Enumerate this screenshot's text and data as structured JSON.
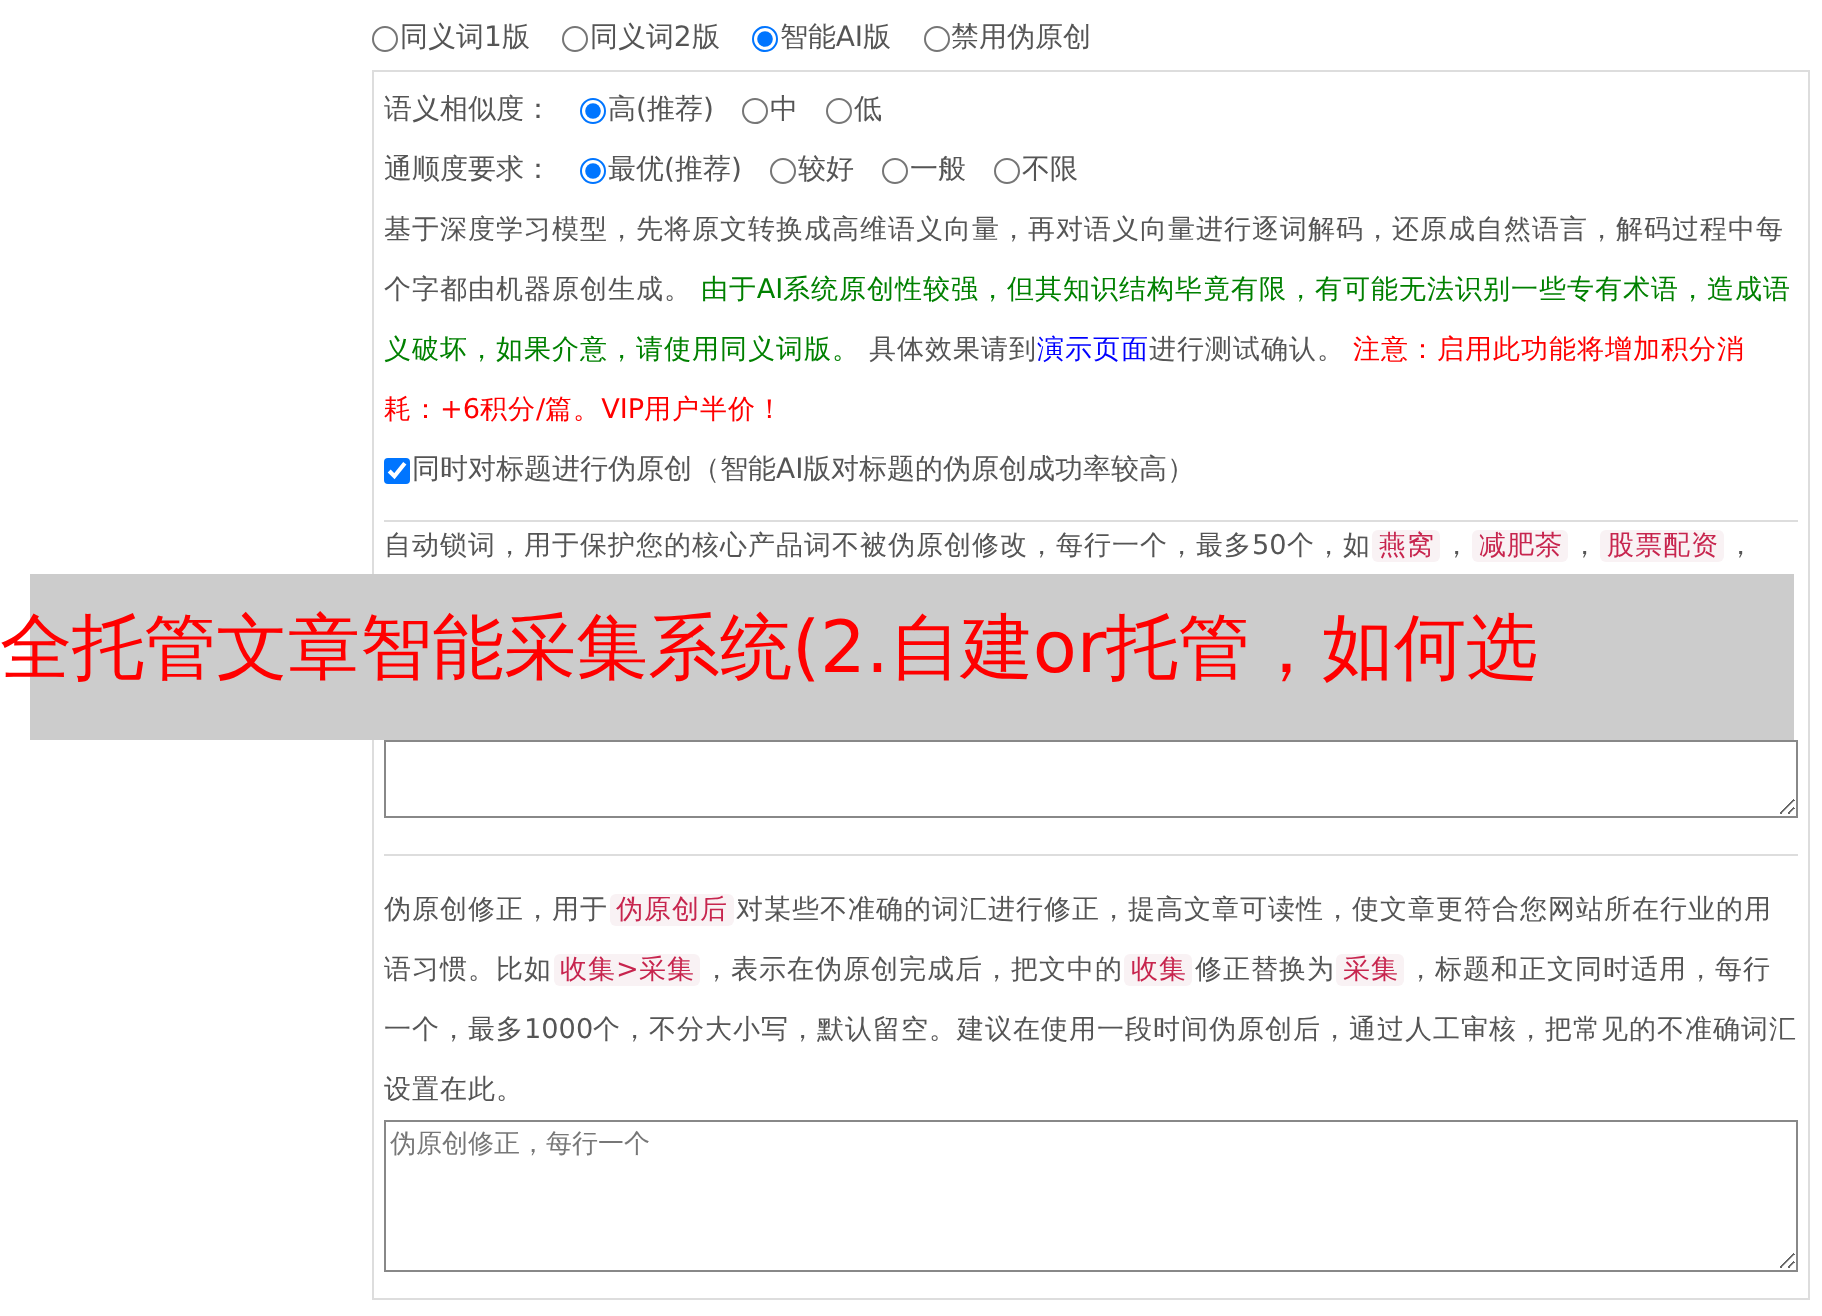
{
  "mode_options": [
    {
      "label": "同义词1版",
      "selected": false
    },
    {
      "label": "同义词2版",
      "selected": false
    },
    {
      "label": "智能AI版",
      "selected": true
    },
    {
      "label": "禁用伪原创",
      "selected": false
    }
  ],
  "similarity": {
    "label": "语义相似度：",
    "options": [
      {
        "label": "高(推荐)",
        "selected": true
      },
      {
        "label": "中",
        "selected": false
      },
      {
        "label": "低",
        "selected": false
      }
    ]
  },
  "fluency": {
    "label": "通顺度要求：",
    "options": [
      {
        "label": "最优(推荐)",
        "selected": true
      },
      {
        "label": "较好",
        "selected": false
      },
      {
        "label": "一般",
        "selected": false
      },
      {
        "label": "不限",
        "selected": false
      }
    ]
  },
  "ai_description": [
    {
      "kind": "plain",
      "text": "基于深度学习模型，先将原文转换成高维语义向量，再对语义向量进行逐词解码，还原成自然语言，解码过程中每个字都由机器原创生成。 "
    },
    {
      "kind": "green",
      "text": "由于AI系统原创性较强，但其知识结构毕竟有限，有可能无法识别一些专有术语，造成语义破坏，如果介意，请使用同义词版。"
    },
    {
      "kind": "plain",
      "text": " 具体效果请到"
    },
    {
      "kind": "link",
      "text": "演示页面"
    },
    {
      "kind": "plain",
      "text": "进行测试确认。 "
    },
    {
      "kind": "red",
      "text": "注意：启用此功能将增加积分消耗：+6积分/篇。VIP用户半价！"
    }
  ],
  "title_checkbox": {
    "label": "同时对标题进行伪原创（智能AI版对标题的伪原创成功率较高）",
    "checked": true
  },
  "lock_words": {
    "description": [
      {
        "kind": "text",
        "text": "自动锁词，用于保护您的核心产品词不被伪原创修改，每行一个，最多50个，如"
      },
      {
        "kind": "tag",
        "text": "燕窝"
      },
      {
        "kind": "text",
        "text": "，"
      },
      {
        "kind": "tag",
        "text": "减肥茶"
      },
      {
        "kind": "text",
        "text": "，"
      },
      {
        "kind": "tag",
        "text": "股票配资"
      },
      {
        "kind": "text",
        "text": "，"
      }
    ]
  },
  "correction": {
    "description": [
      {
        "kind": "text",
        "text": "伪原创修正，用于"
      },
      {
        "kind": "tag",
        "text": "伪原创后"
      },
      {
        "kind": "text",
        "text": "对某些不准确的词汇进行修正，提高文章可读性，使文章更符合您网站所在行业的用语习惯。比如"
      },
      {
        "kind": "tag",
        "text": "收集>采集"
      },
      {
        "kind": "text",
        "text": "，表示在伪原创完成后，把文中的"
      },
      {
        "kind": "tag",
        "text": "收集"
      },
      {
        "kind": "text",
        "text": "修正替换为"
      },
      {
        "kind": "tag",
        "text": "采集"
      },
      {
        "kind": "text",
        "text": "，标题和正文同时适用，每行一个，最多1000个，不分大小写，默认留空。建议在使用一段时间伪原创后，通过人工审核，把常见的不准确词汇设置在此。"
      }
    ],
    "placeholder": "伪原创修正，每行一个"
  },
  "banner": {
    "text": "全托管文章智能采集系统(2.自建or托管，如何选"
  }
}
